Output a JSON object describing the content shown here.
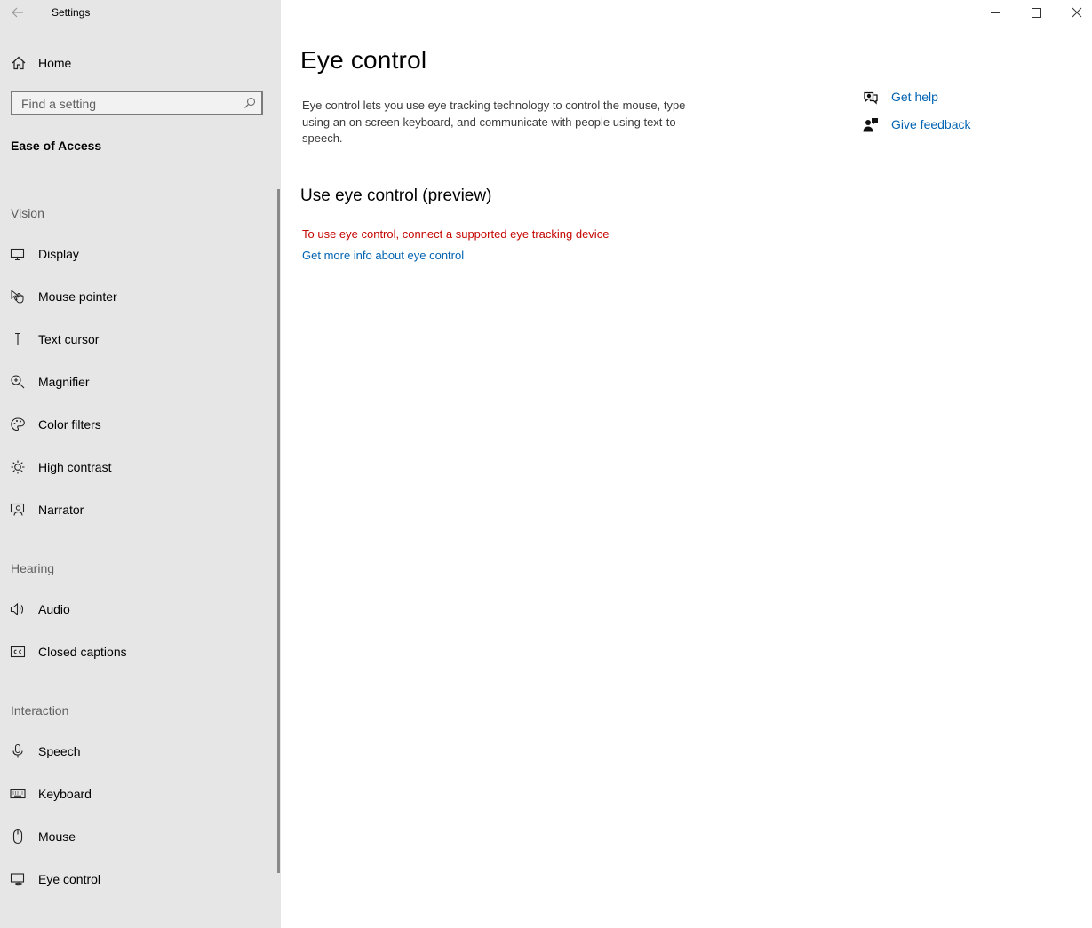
{
  "window": {
    "title": "Settings",
    "controls": {
      "minimize_icon": "minimize-icon",
      "maximize_icon": "maximize-icon",
      "close_icon": "close-icon"
    }
  },
  "sidebar": {
    "home_label": "Home",
    "search_placeholder": "Find a setting",
    "category": "Ease of Access",
    "sections": [
      {
        "header": "Vision",
        "items": [
          {
            "label": "Display",
            "icon": "display-icon"
          },
          {
            "label": "Mouse pointer",
            "icon": "mouse-pointer-icon"
          },
          {
            "label": "Text cursor",
            "icon": "text-cursor-icon"
          },
          {
            "label": "Magnifier",
            "icon": "magnifier-icon"
          },
          {
            "label": "Color filters",
            "icon": "color-filters-icon"
          },
          {
            "label": "High contrast",
            "icon": "high-contrast-icon"
          },
          {
            "label": "Narrator",
            "icon": "narrator-icon"
          }
        ]
      },
      {
        "header": "Hearing",
        "items": [
          {
            "label": "Audio",
            "icon": "audio-icon"
          },
          {
            "label": "Closed captions",
            "icon": "closed-captions-icon"
          }
        ]
      },
      {
        "header": "Interaction",
        "items": [
          {
            "label": "Speech",
            "icon": "microphone-icon"
          },
          {
            "label": "Keyboard",
            "icon": "keyboard-icon"
          },
          {
            "label": "Mouse",
            "icon": "mouse-icon"
          },
          {
            "label": "Eye control",
            "icon": "eye-control-icon"
          }
        ]
      }
    ],
    "selected": "Eye control"
  },
  "main": {
    "title": "Eye control",
    "description": "Eye control lets you use eye tracking technology to control the mouse, type using an on screen keyboard, and communicate with people using text-to-speech.",
    "section_title": "Use eye control (preview)",
    "error_text": "To use eye control, connect a supported eye tracking device",
    "info_link": "Get more info about eye control",
    "help": {
      "get_help": "Get help",
      "give_feedback": "Give feedback"
    }
  },
  "colors": {
    "sidebar_bg": "#e6e6e6",
    "link": "#0063b1",
    "error": "#c50500"
  }
}
